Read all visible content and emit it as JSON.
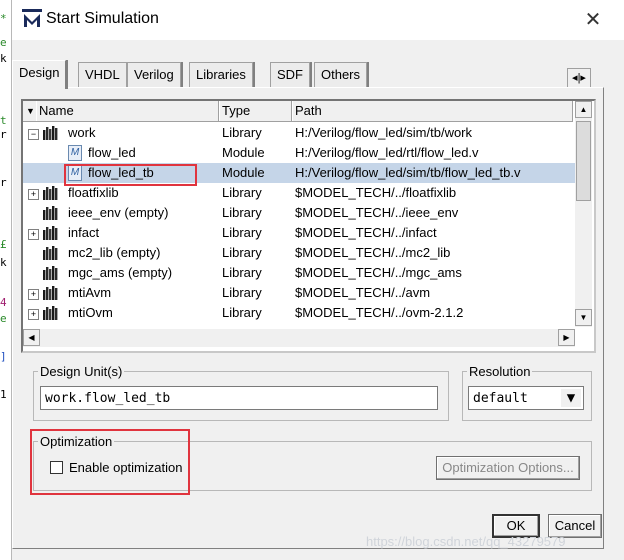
{
  "window": {
    "title": "Start Simulation"
  },
  "tabs": [
    "Design",
    "VHDL",
    "Verilog",
    "Libraries",
    "SDF",
    "Others"
  ],
  "tree": {
    "columns": [
      "Name",
      "Type",
      "Path"
    ],
    "rows": [
      {
        "name": "work",
        "type": "Library",
        "path": "H:/Verilog/flow_led/sim/tb/work",
        "kind": "library",
        "expander": "-",
        "selected": false
      },
      {
        "name": "flow_led",
        "type": "Module",
        "path": "H:/Verilog/flow_led/rtl/flow_led.v",
        "kind": "module",
        "expander": "",
        "selected": false
      },
      {
        "name": "flow_led_tb",
        "type": "Module",
        "path": "H:/Verilog/flow_led/sim/tb/flow_led_tb.v",
        "kind": "module",
        "expander": "",
        "selected": true
      },
      {
        "name": "floatfixlib",
        "type": "Library",
        "path": "$MODEL_TECH/../floatfixlib",
        "kind": "library",
        "expander": "+",
        "selected": false
      },
      {
        "name": "ieee_env  (empty)",
        "type": "Library",
        "path": "$MODEL_TECH/../ieee_env",
        "kind": "library",
        "expander": "",
        "selected": false
      },
      {
        "name": "infact",
        "type": "Library",
        "path": "$MODEL_TECH/../infact",
        "kind": "library",
        "expander": "+",
        "selected": false
      },
      {
        "name": "mc2_lib  (empty)",
        "type": "Library",
        "path": "$MODEL_TECH/../mc2_lib",
        "kind": "library",
        "expander": "",
        "selected": false
      },
      {
        "name": "mgc_ams  (empty)",
        "type": "Library",
        "path": "$MODEL_TECH/../mgc_ams",
        "kind": "library",
        "expander": "",
        "selected": false
      },
      {
        "name": "mtiAvm",
        "type": "Library",
        "path": "$MODEL_TECH/../avm",
        "kind": "library",
        "expander": "+",
        "selected": false
      },
      {
        "name": "mtiOvm",
        "type": "Library",
        "path": "$MODEL_TECH/../ovm-2.1.2",
        "kind": "library",
        "expander": "+",
        "selected": false
      }
    ]
  },
  "design_unit": {
    "label": "Design Unit(s)",
    "value": "work.flow_led_tb"
  },
  "resolution": {
    "label": "Resolution",
    "value": "default"
  },
  "optimization": {
    "label": "Optimization",
    "checkbox_label": "Enable optimization",
    "checked": false,
    "options_button": "Optimization Options..."
  },
  "buttons": {
    "ok": "OK",
    "cancel": "Cancel"
  },
  "watermark": "https://blog.csdn.net/qq_43279579",
  "colors": {
    "highlight": "#e0343e",
    "selected_row": "#c5d5e8"
  }
}
